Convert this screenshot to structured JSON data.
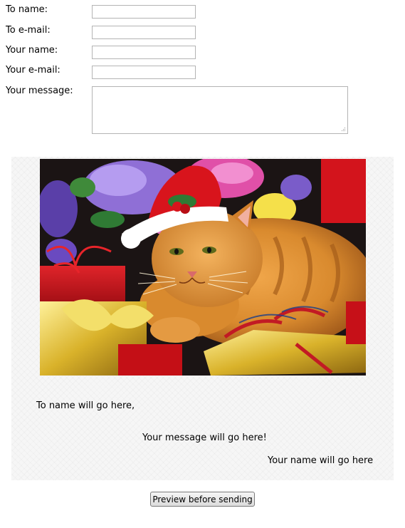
{
  "form": {
    "to_name_label": "To name:",
    "to_email_label": "To e-mail:",
    "your_name_label": "Your name:",
    "your_email_label": "Your e-mail:",
    "your_message_label": "Your message:",
    "to_name_value": "",
    "to_email_value": "",
    "your_name_value": "",
    "your_email_value": "",
    "message_value": ""
  },
  "card": {
    "image_subject": "cat-in-santa-hat-with-presents",
    "greeting": "To name will go here,",
    "message": "Your message will go here!",
    "signature": "Your name will go here"
  },
  "actions": {
    "preview_label": "Preview before sending"
  },
  "colors": {
    "card_background": "#f6f6f6",
    "button_border": "#7a7a7a"
  }
}
